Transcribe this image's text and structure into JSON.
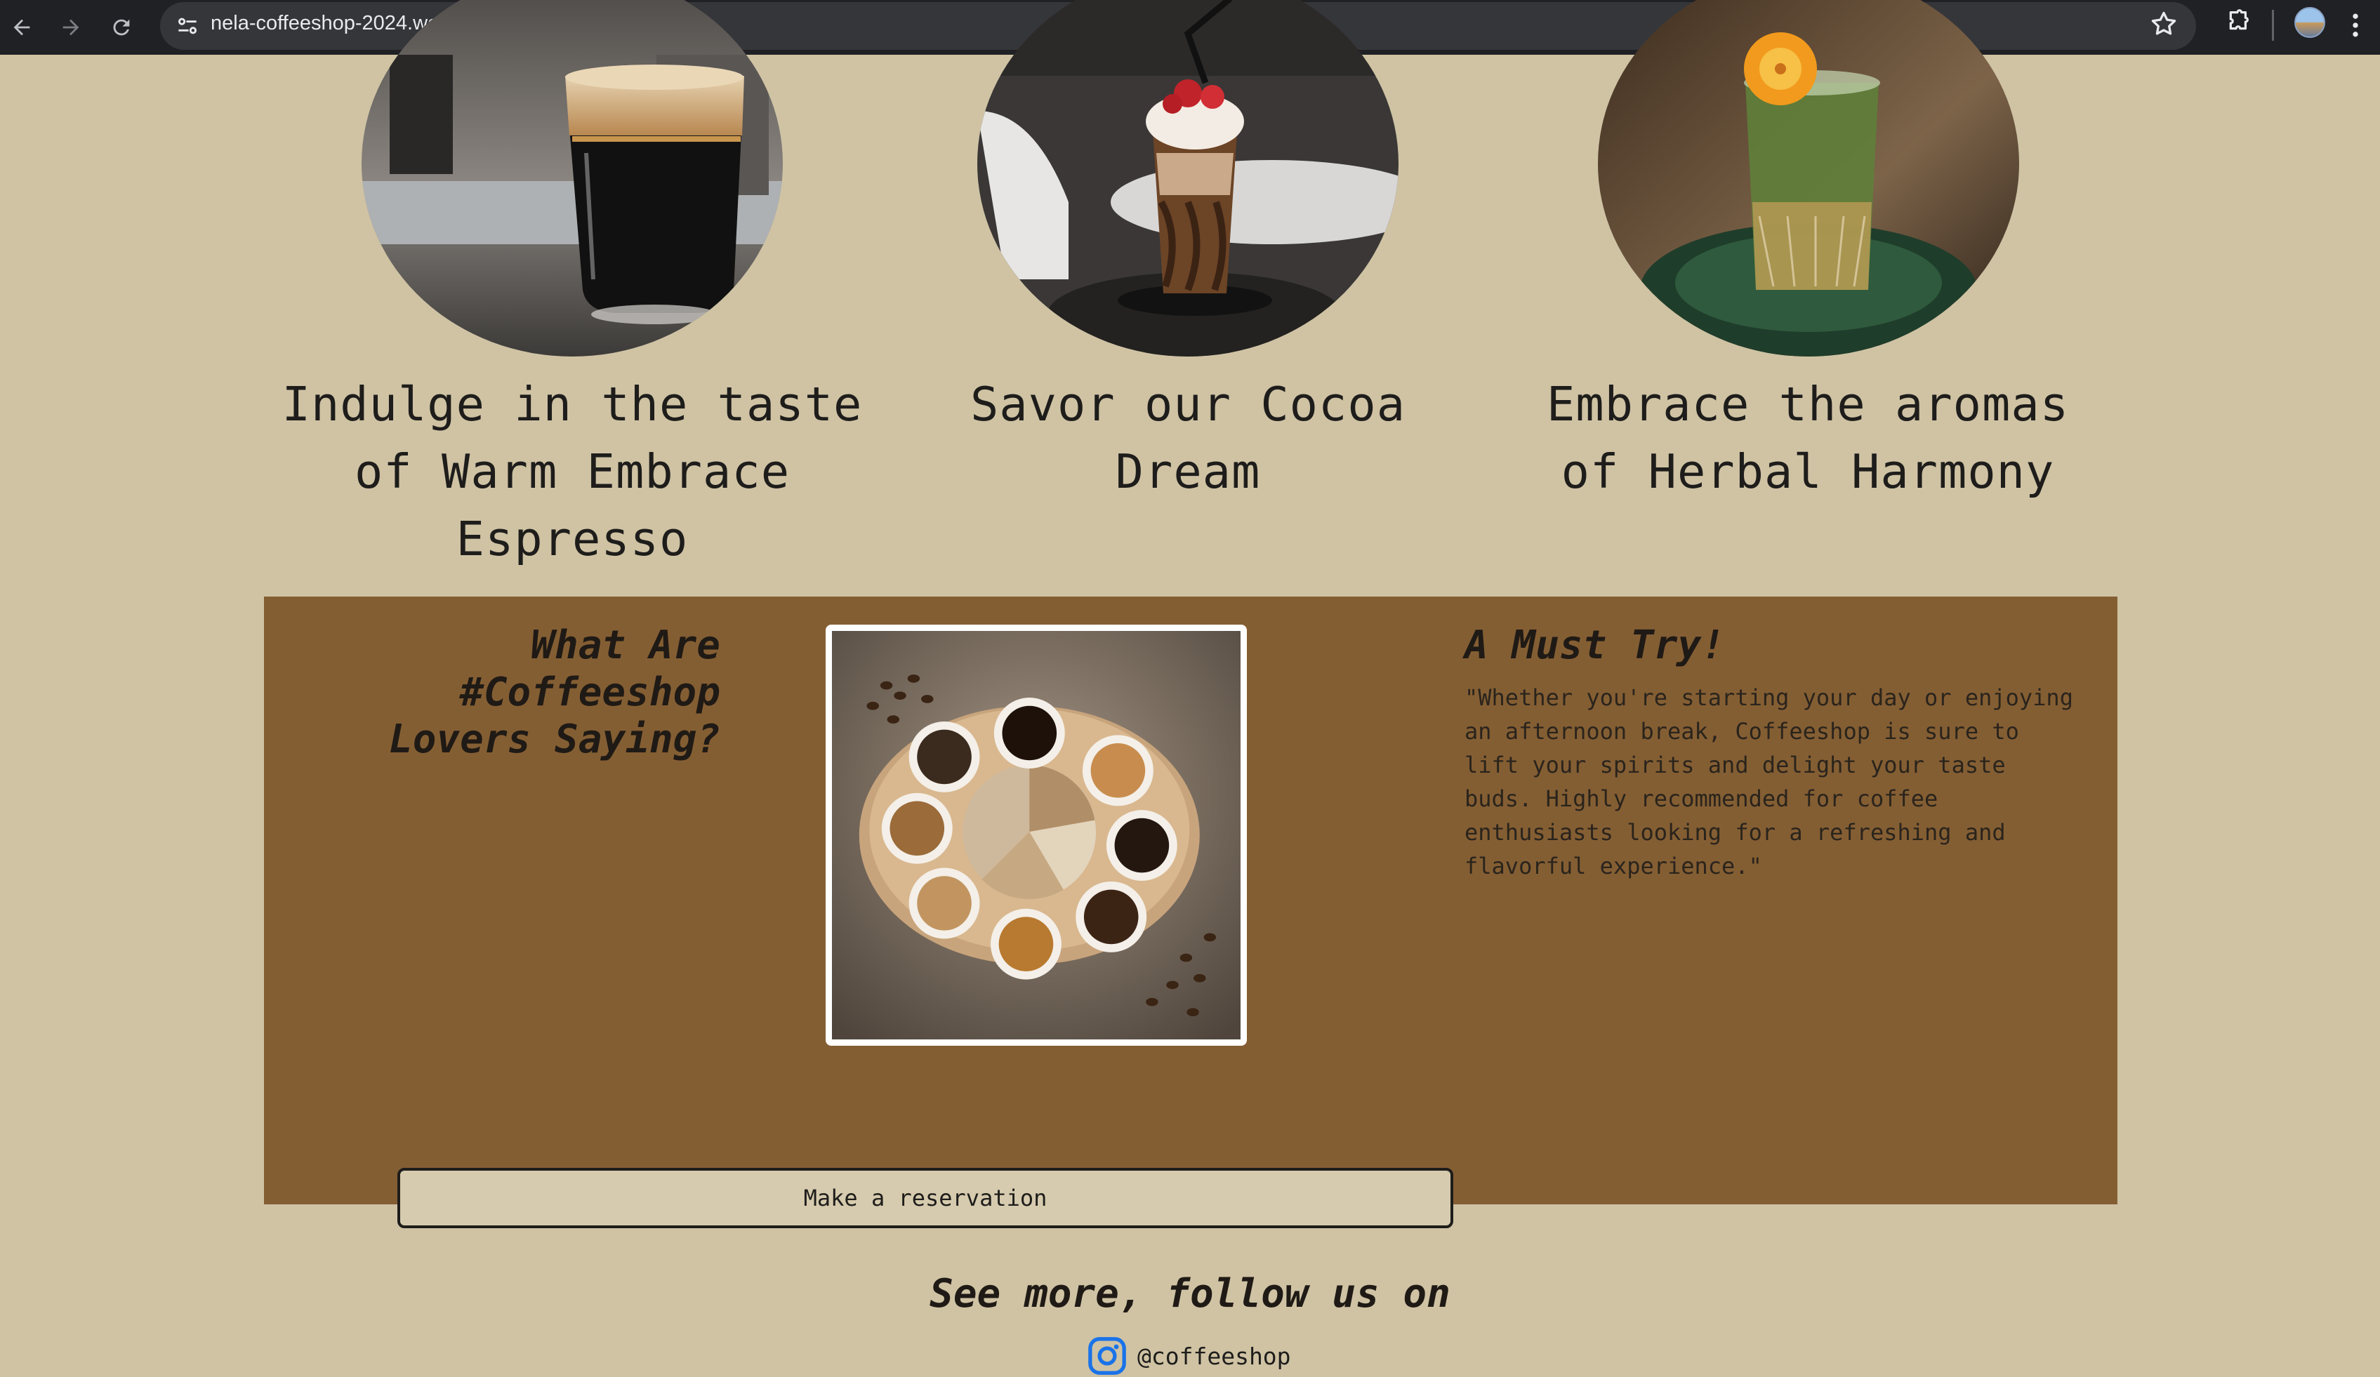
{
  "browser": {
    "url": "nela-coffeeshop-2024.web.app"
  },
  "drinks": [
    {
      "title": "Indulge in the taste of Warm Embrace Espresso",
      "image": "espresso-glass-image"
    },
    {
      "title": "Savor our Cocoa Dream",
      "image": "cocoa-dream-image"
    },
    {
      "title": "Embrace the aromas of Herbal Harmony",
      "image": "herbal-harmony-image"
    }
  ],
  "reviews": {
    "heading": "What Are #Coffeeshop Lovers Saying?",
    "must_try_title": "A Must Try!",
    "quote": "\"Whether you're starting your day or enjoying an afternoon break, Coffeeshop is sure to lift your spirits and delight your taste buds. Highly recommended for coffee enthusiasts looking for a refreshing and flavorful experience.\"",
    "photo": "coffee-tray-image"
  },
  "reservation": {
    "button_label": "Make a reservation"
  },
  "social": {
    "follow_text": "See more, follow us on",
    "handle": "@coffeeshop",
    "icon": "instagram-icon"
  },
  "colors": {
    "page_bg": "#cfc3a4",
    "panel_bg": "#845e33",
    "button_bg": "#d6cbae",
    "text": "#1e1d1b",
    "instagram_blue": "#1a73e8"
  }
}
